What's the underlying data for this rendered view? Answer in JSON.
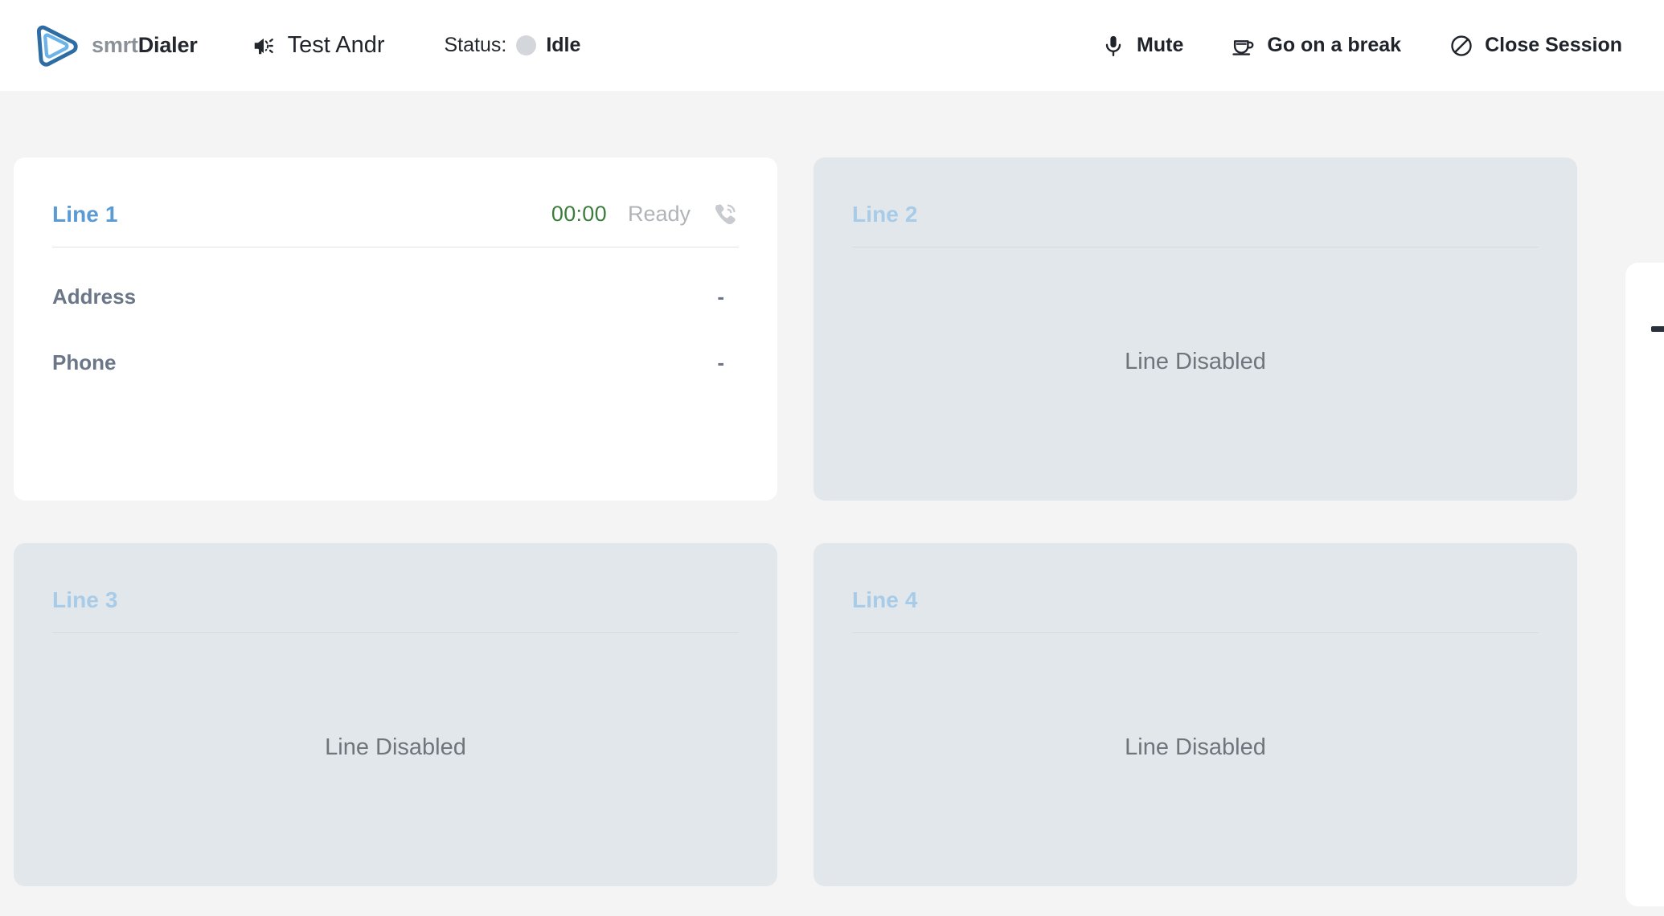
{
  "app": {
    "brand_light": "smrt",
    "brand_bold": "Dialer",
    "logo_outer_color": "#2e6ca4",
    "logo_inner_color": "#6bb3e8"
  },
  "header": {
    "campaign_icon": "megaphone-icon",
    "campaign_name": "Test Andr",
    "status_label": "Status:",
    "status_value": "Idle",
    "status_dot_color": "#d3d6da",
    "actions": [
      {
        "icon": "microphone-icon",
        "label": "Mute"
      },
      {
        "icon": "coffee-cup-icon",
        "label": "Go on a break"
      },
      {
        "icon": "prohibition-circle-icon",
        "label": "Close Session"
      }
    ]
  },
  "lines": [
    {
      "title": "Line 1",
      "state": "active",
      "timer": "00:00",
      "status": "Ready",
      "status_icon": "phone-ringing-icon",
      "title_color": "#5a9bd5",
      "timer_color": "#3b7d3b",
      "details": [
        {
          "label": "Address",
          "value": "-"
        },
        {
          "label": "Phone",
          "value": "-"
        }
      ]
    },
    {
      "title": "Line 2",
      "state": "disabled",
      "disabled_message": "Line Disabled",
      "title_color": "#a8cbe8"
    },
    {
      "title": "Line 3",
      "state": "disabled",
      "disabled_message": "Line Disabled",
      "title_color": "#a8cbe8"
    },
    {
      "title": "Line 4",
      "state": "disabled",
      "disabled_message": "Line Disabled",
      "title_color": "#a8cbe8"
    }
  ],
  "edge_panel": {
    "handle_icon": "minus-dash-icon"
  },
  "colors": {
    "page_background": "#f4f4f5",
    "header_background": "#ffffff",
    "card_active_background": "#ffffff",
    "card_disabled_background": "#e2e7eb",
    "text_primary": "#1f232a",
    "text_muted": "#6b7789"
  }
}
